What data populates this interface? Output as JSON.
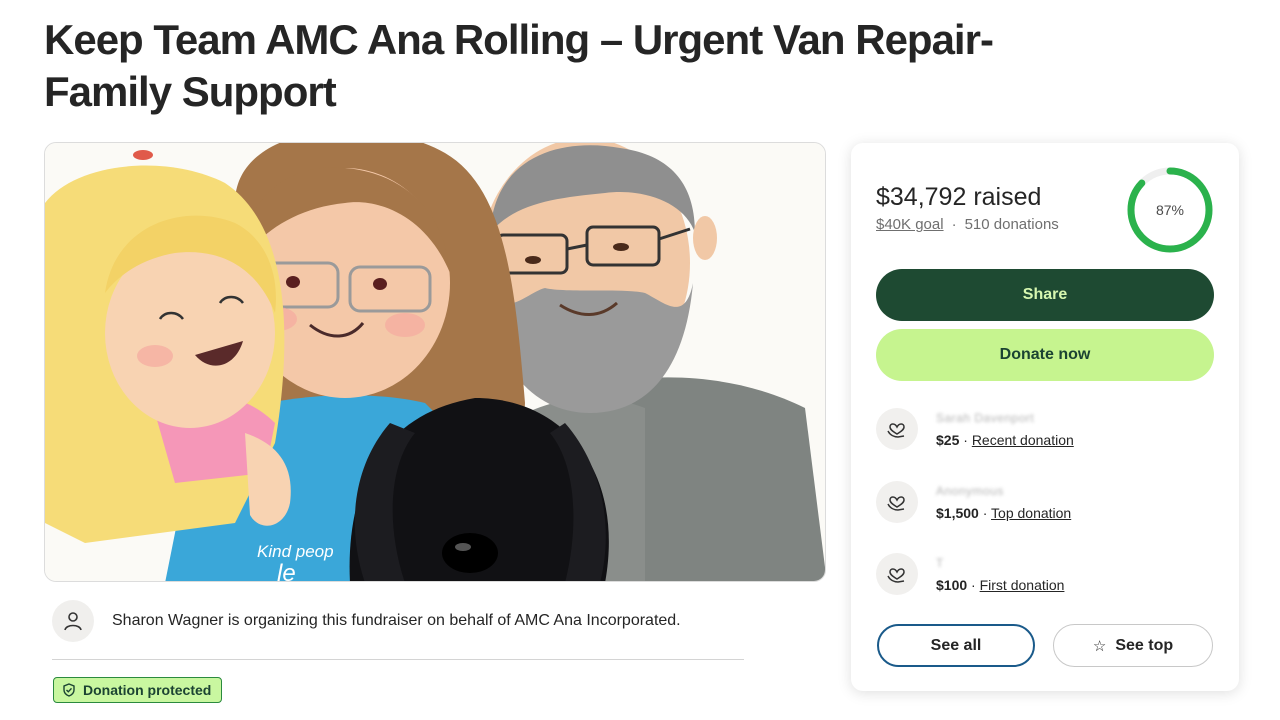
{
  "page": {
    "title": "Keep Team AMC Ana Rolling – Urgent Van Repair-Family Support"
  },
  "hero": {
    "shirt_text_1": "Kind peop",
    "shirt_text_2": "le"
  },
  "organizer": {
    "text": "Sharon Wagner is organizing this fundraiser on behalf of AMC Ana Incorporated.",
    "icon": "person-icon"
  },
  "badge": {
    "label": "Donation protected",
    "icon": "shield-icon"
  },
  "summary": {
    "raised": "$34,792 raised",
    "goal": "$40K goal",
    "separator": "·",
    "donations": "510 donations",
    "progress_label": "87%",
    "progress_fraction": 0.87
  },
  "actions": {
    "share": "Share",
    "donate": "Donate now"
  },
  "donations": [
    {
      "name": "Sarah Davenport",
      "amount": "$25",
      "sep": " · ",
      "label": "Recent donation",
      "icon": "heart-hands-icon"
    },
    {
      "name": "Anonymous",
      "amount": "$1,500",
      "sep": " · ",
      "label": "Top donation",
      "icon": "heart-hands-icon"
    },
    {
      "name": "T",
      "amount": "$100",
      "sep": " · ",
      "label": "First donation",
      "icon": "heart-hands-icon"
    }
  ],
  "footer_buttons": {
    "see_all": "See all",
    "see_top": "See top",
    "star_icon": "star-icon"
  },
  "colors": {
    "share_bg": "#1e4a32",
    "donate_bg": "#c6f48f",
    "progress": "#2bb24c",
    "protected_bg": "#c9f7a0"
  }
}
